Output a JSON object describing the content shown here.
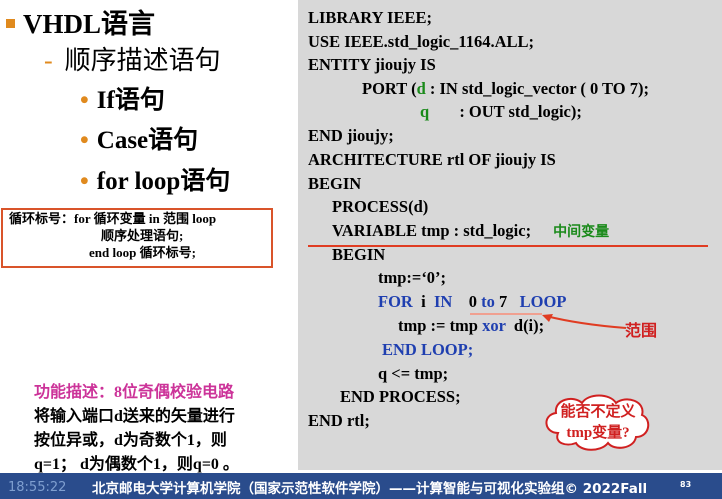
{
  "outline": {
    "heading": "VHDL语言",
    "sub": "顺序描述语句",
    "items": [
      "If语句",
      "Case语句",
      "for loop语句"
    ]
  },
  "syntax": {
    "lines": [
      "循环标号：for 循环变量 in 范围 loop",
      "顺序处理语句;",
      "end loop 循环标号;"
    ]
  },
  "func": {
    "title": "功能描述：8位奇偶校验电路",
    "lines": [
      "将输入端口d送来的矢量进行",
      "按位异或，d为奇数个1，则",
      "q=1； d为偶数个1，则q=0 。"
    ]
  },
  "code": {
    "library": "LIBRARY IEEE;",
    "use": "USE IEEE.std_logic_1164.ALL;",
    "entity": "ENTITY jioujy IS",
    "port_pre": "PORT (",
    "port_d": "d",
    "port_rest": " : IN  std_logic_vector ( 0 TO 7);",
    "port_q": "q",
    "port_q_rest": " : OUT std_logic);",
    "end_entity": "END jioujy;",
    "arch": "ARCHITECTURE  rtl OF jioujy IS",
    "begin1": "BEGIN",
    "process": "PROCESS(d)",
    "variable": "VARIABLE   tmp : std_logic;",
    "middle_var": "中间变量",
    "begin2": "BEGIN",
    "tmp_init": "tmp:=‘0’;",
    "for_kw": "FOR",
    "for_i": "  i  ",
    "in_kw": "IN",
    "range_0": "    0",
    "to_kw": " to ",
    "range_7": "7",
    "loop_kw": "   LOOP",
    "tmp_assign": "tmp := tmp ",
    "xor_kw": "xor",
    "tmp_assign_rest": "  d(i);",
    "end_loop": "END LOOP;",
    "q_assign": "q <= tmp;",
    "end_process": "END PROCESS;",
    "end_rtl": "END rtl;"
  },
  "annotations": {
    "range": "范围",
    "cloud_line1": "能否不定义",
    "cloud_line2": "tmp变量?"
  },
  "footer": {
    "time": "18:55:22",
    "text": "北京邮电大学计算机学院（国家示范性软件学院）——计算智能与可视化实验组© 2022Fall",
    "page": "83"
  }
}
